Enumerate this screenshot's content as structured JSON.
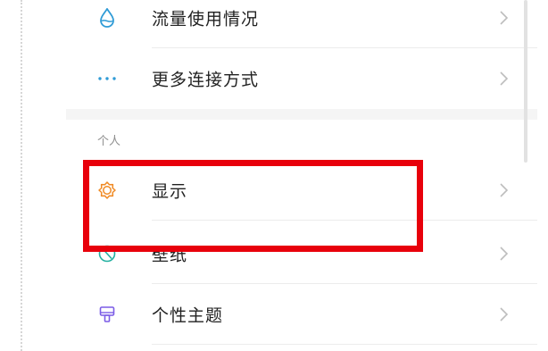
{
  "network": {
    "items": [
      {
        "label": "流量使用情况",
        "icon": "water-drop-icon"
      },
      {
        "label": "更多连接方式",
        "icon": "more-dots-icon"
      }
    ]
  },
  "personal": {
    "header": "个人",
    "items": [
      {
        "label": "显示",
        "icon": "sun-icon"
      },
      {
        "label": "壁纸",
        "icon": "wallpaper-icon"
      },
      {
        "label": "个性主题",
        "icon": "theme-brush-icon"
      }
    ]
  },
  "annotation": {
    "highlight_color": "#e8000b",
    "highlighted_item": "显示"
  },
  "colors": {
    "drop_icon": "#2f9bd6",
    "dots_icon": "#2f9bd6",
    "sun_icon": "#f08a24",
    "wallpaper_icon": "#22b0a0",
    "theme_icon": "#7b5ce6",
    "chevron": "#bdbdbd"
  }
}
